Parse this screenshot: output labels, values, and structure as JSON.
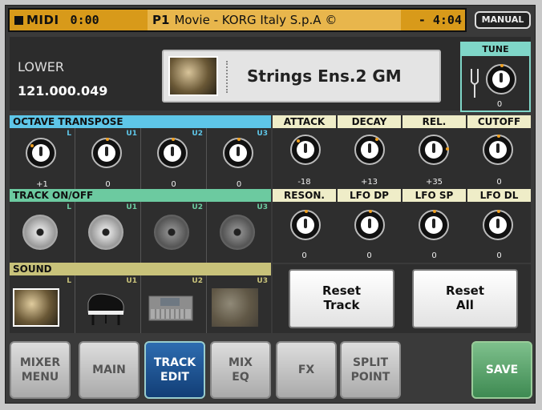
{
  "topbar": {
    "midi": "MIDI",
    "time": "0:00",
    "song_slot": "P1",
    "song_title": "Movie - KORG Italy S.p.A ©",
    "remaining": "- 4:04"
  },
  "manual_label": "MANUAL",
  "header": {
    "part": "LOWER",
    "code": "121.000.049",
    "sound_name": "Strings Ens.2 GM"
  },
  "tune": {
    "label": "TUNE",
    "value": "0"
  },
  "octave": {
    "title": "OCTAVE TRANSPOSE",
    "cells": [
      {
        "tag": "L",
        "value": "+1"
      },
      {
        "tag": "U1",
        "value": "0"
      },
      {
        "tag": "U2",
        "value": "0"
      },
      {
        "tag": "U3",
        "value": "0"
      }
    ]
  },
  "track": {
    "title": "TRACK ON/OFF",
    "cells": [
      {
        "tag": "L",
        "on": true
      },
      {
        "tag": "U1",
        "on": true
      },
      {
        "tag": "U2",
        "on": false
      },
      {
        "tag": "U3",
        "on": false
      }
    ]
  },
  "sound": {
    "title": "SOUND",
    "cells": [
      {
        "tag": "L",
        "icon": "strings-icon"
      },
      {
        "tag": "U1",
        "icon": "piano-icon"
      },
      {
        "tag": "U2",
        "icon": "keyboard-icon"
      },
      {
        "tag": "U3",
        "icon": "strings-icon"
      }
    ]
  },
  "envelope": [
    {
      "label": "ATTACK",
      "value": "-18"
    },
    {
      "label": "DECAY",
      "value": "+13"
    },
    {
      "label": "REL.",
      "value": "+35"
    },
    {
      "label": "CUTOFF",
      "value": "0"
    }
  ],
  "lfo": [
    {
      "label": "RESON.",
      "value": "0"
    },
    {
      "label": "LFO DP",
      "value": "0"
    },
    {
      "label": "LFO SP",
      "value": "0"
    },
    {
      "label": "LFO DL",
      "value": "0"
    }
  ],
  "actions": {
    "reset_track_1": "Reset",
    "reset_track_2": "Track",
    "reset_all_1": "Reset",
    "reset_all_2": "All"
  },
  "nav": [
    {
      "l1": "MIXER",
      "l2": "MENU"
    },
    {
      "l1": "MAIN",
      "l2": ""
    },
    {
      "l1": "TRACK",
      "l2": "EDIT"
    },
    {
      "l1": "MIX",
      "l2": "EQ"
    },
    {
      "l1": "FX",
      "l2": ""
    },
    {
      "l1": "SPLIT",
      "l2": "POINT"
    },
    {
      "l1": "SAVE",
      "l2": ""
    }
  ],
  "colors": {
    "topbar": "#d89a1a",
    "octave": "#5ec6e8",
    "track": "#6ccaa0",
    "sound": "#c8c27a",
    "active_tab": "#2d6cb0",
    "save": "#3e8a52"
  }
}
